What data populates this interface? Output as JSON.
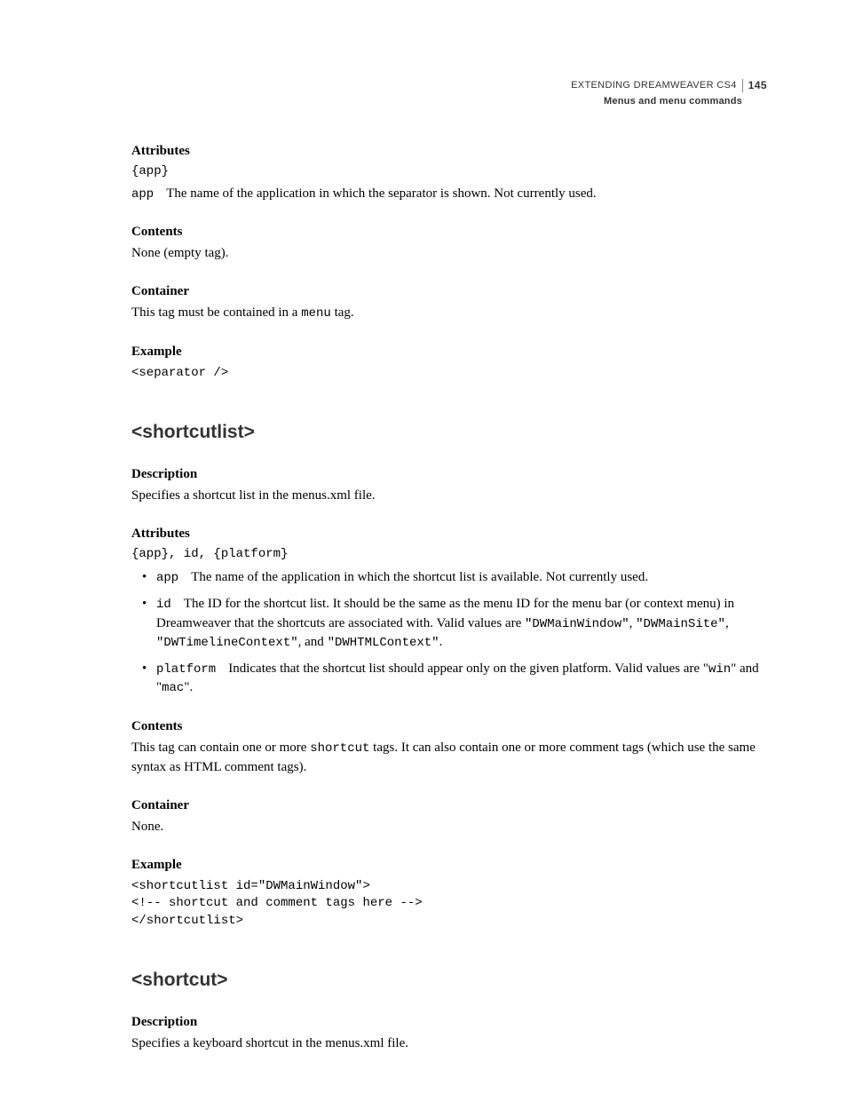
{
  "header": {
    "book": "EXTENDING DREAMWEAVER CS4",
    "chapter": "Menus and menu commands",
    "page": "145"
  },
  "s1": {
    "attributes": {
      "heading": "Attributes",
      "signature": "{app}",
      "app_name": "app",
      "app_desc": "The name of the application in which the separator is shown. Not currently used."
    },
    "contents": {
      "heading": "Contents",
      "text": "None (empty tag)."
    },
    "container": {
      "heading": "Container",
      "prefix": "This tag must be contained in a ",
      "tag": "menu",
      "suffix": " tag."
    },
    "example": {
      "heading": "Example",
      "code": "<separator />"
    }
  },
  "s2": {
    "title": "<shortcutlist>",
    "description": {
      "heading": "Description",
      "text": "Specifies a shortcut list in the menus.xml file."
    },
    "attributes": {
      "heading": "Attributes",
      "signature": "{app}, id, {platform}",
      "items": {
        "app": {
          "name": "app",
          "text": "The name of the application in which the shortcut list is available. Not currently used."
        },
        "id": {
          "name": "id",
          "t1": "The ID for the shortcut list. It should be the same as the menu ID for the menu bar (or context menu) in Dreamweaver that the shortcuts are associated with. Valid values are ",
          "v1": "\"DWMainWindow\"",
          "c1": ", ",
          "v2": "\"DWMainSite\"",
          "c2": ", ",
          "v3": "\"DWTimelineContext\"",
          "c3": ", and ",
          "v4": "\"DWHTMLContext\"",
          "c4": "."
        },
        "platform": {
          "name": "platform",
          "t1": "Indicates that the shortcut list should appear only on the given platform. Valid values are \"",
          "v1": "win",
          "t2": "\" and \"",
          "v2": "mac",
          "t3": "\"."
        }
      }
    },
    "contents": {
      "heading": "Contents",
      "t1": "This tag can contain one or more ",
      "tag": "shortcut",
      "t2": " tags. It can also contain one or more comment tags (which use the same syntax as HTML comment tags)."
    },
    "container": {
      "heading": "Container",
      "text": "None."
    },
    "example": {
      "heading": "Example",
      "code": "<shortcutlist id=\"DWMainWindow\">\n<!-- shortcut and comment tags here -->\n</shortcutlist>"
    }
  },
  "s3": {
    "title": "<shortcut>",
    "description": {
      "heading": "Description",
      "text": "Specifies a keyboard shortcut in the menus.xml file."
    }
  }
}
